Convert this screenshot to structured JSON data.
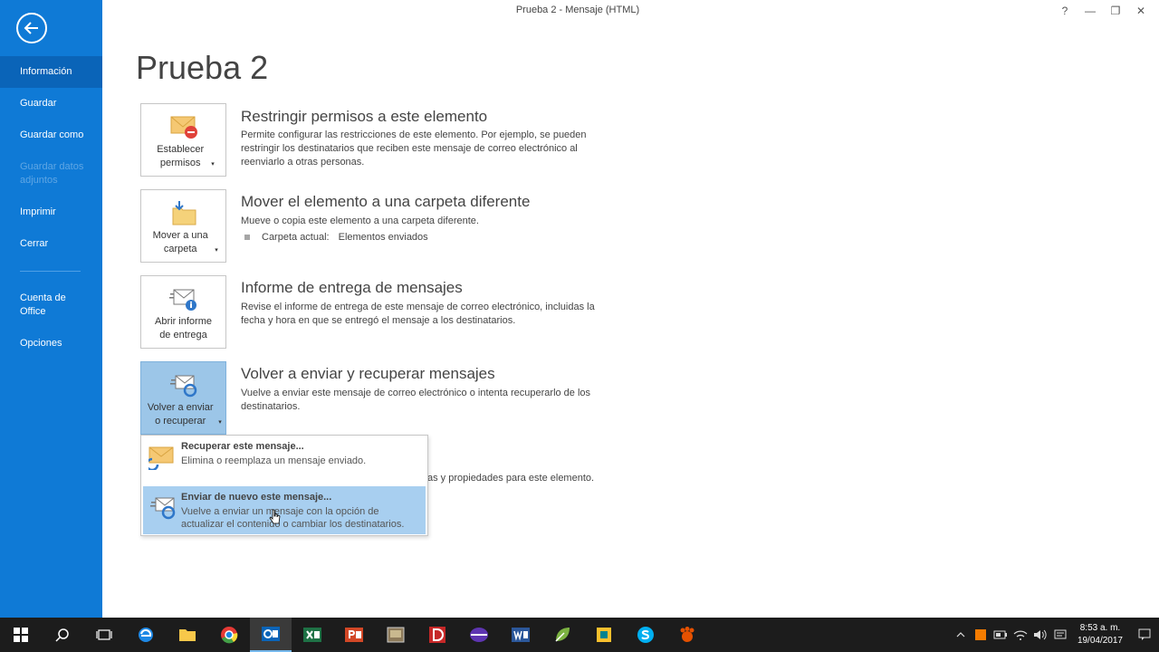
{
  "window": {
    "title": "Prueba 2 - Mensaje (HTML)",
    "help": "?",
    "minimize": "—",
    "restore": "❐",
    "close": "✕"
  },
  "sidebar": {
    "items": [
      {
        "label": "Información",
        "active": true
      },
      {
        "label": "Guardar"
      },
      {
        "label": "Guardar como"
      },
      {
        "label": "Guardar datos adjuntos",
        "disabled": true
      },
      {
        "label": "Imprimir"
      },
      {
        "label": "Cerrar"
      },
      {
        "label": "Cuenta de Office"
      },
      {
        "label": "Opciones"
      }
    ]
  },
  "page": {
    "title": "Prueba 2"
  },
  "sections": {
    "permissions": {
      "tile_label": "Establecer permisos",
      "title": "Restringir permisos a este elemento",
      "desc": "Permite configurar las restricciones de este elemento. Por ejemplo, se pueden restringir los destinatarios que reciben este mensaje de correo electrónico al reenviarlo a otras personas."
    },
    "move": {
      "tile_label": "Mover a una carpeta",
      "title": "Mover el elemento a una carpeta diferente",
      "desc": "Mueve o copia este elemento a una carpeta diferente.",
      "folder_label": "Carpeta actual:",
      "folder_value": "Elementos enviados"
    },
    "delivery": {
      "tile_label": "Abrir informe de entrega",
      "title": "Informe de entrega de mensajes",
      "desc": "Revise el informe de entrega de este mensaje de correo electrónico, incluidas la fecha y hora en que se entregó el mensaje a los destinatarios."
    },
    "resend": {
      "tile_label": "Volver a enviar o recuperar",
      "title": "Volver a enviar y recuperar mensajes",
      "desc": "Vuelve a enviar este mensaje de correo electrónico o intenta recuperarlo de los destinatarios."
    },
    "properties": {
      "partial_desc": "as y propiedades para este elemento."
    }
  },
  "dropdown": {
    "items": [
      {
        "title": "Recuperar este mensaje...",
        "desc": "Elimina o reemplaza un mensaje enviado."
      },
      {
        "title": "Enviar de nuevo este mensaje...",
        "desc": "Vuelve a enviar un mensaje con la opción de actualizar el contenido o cambiar los destinatarios."
      }
    ]
  },
  "taskbar": {
    "time": "8:53 a. m.",
    "date": "19/04/2017"
  },
  "colors": {
    "sidebar": "#0f7ad6",
    "sidebar_active": "#0a64b8",
    "selected_tile": "#9cc6e8",
    "hover_item": "#a8cff0",
    "taskbar": "#1c1c1c"
  }
}
